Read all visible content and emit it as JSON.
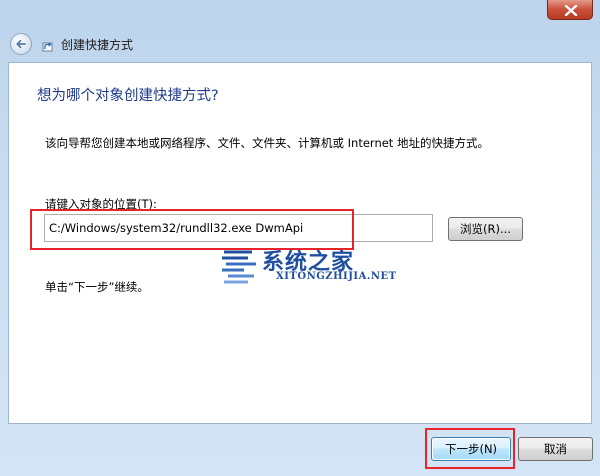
{
  "window": {
    "title": "创建快捷方式",
    "close_icon": "close-icon",
    "back_icon": "back-arrow-icon",
    "wizard_icon": "shortcut-wizard-icon"
  },
  "content": {
    "heading": "想为哪个对象创建快捷方式?",
    "description": "该向导帮您创建本地或网络程序、文件、文件夹、计算机或 Internet 地址的快捷方式。",
    "location_label": "请键入对象的位置(T):",
    "location_value": "C:/Windows/system32/rundll32.exe DwmApi",
    "browse_label": "浏览(R)...",
    "hint": "单击“下一步”继续。"
  },
  "watermark": {
    "title": "系统之家",
    "subtitle": "XITONGZHIJIA.NET"
  },
  "footer": {
    "next_label": "下一步(N)",
    "cancel_label": "取消"
  },
  "colors": {
    "accent_heading": "#1f3b8c",
    "highlight_red": "#e8242a",
    "frame": "#c9dcef"
  }
}
